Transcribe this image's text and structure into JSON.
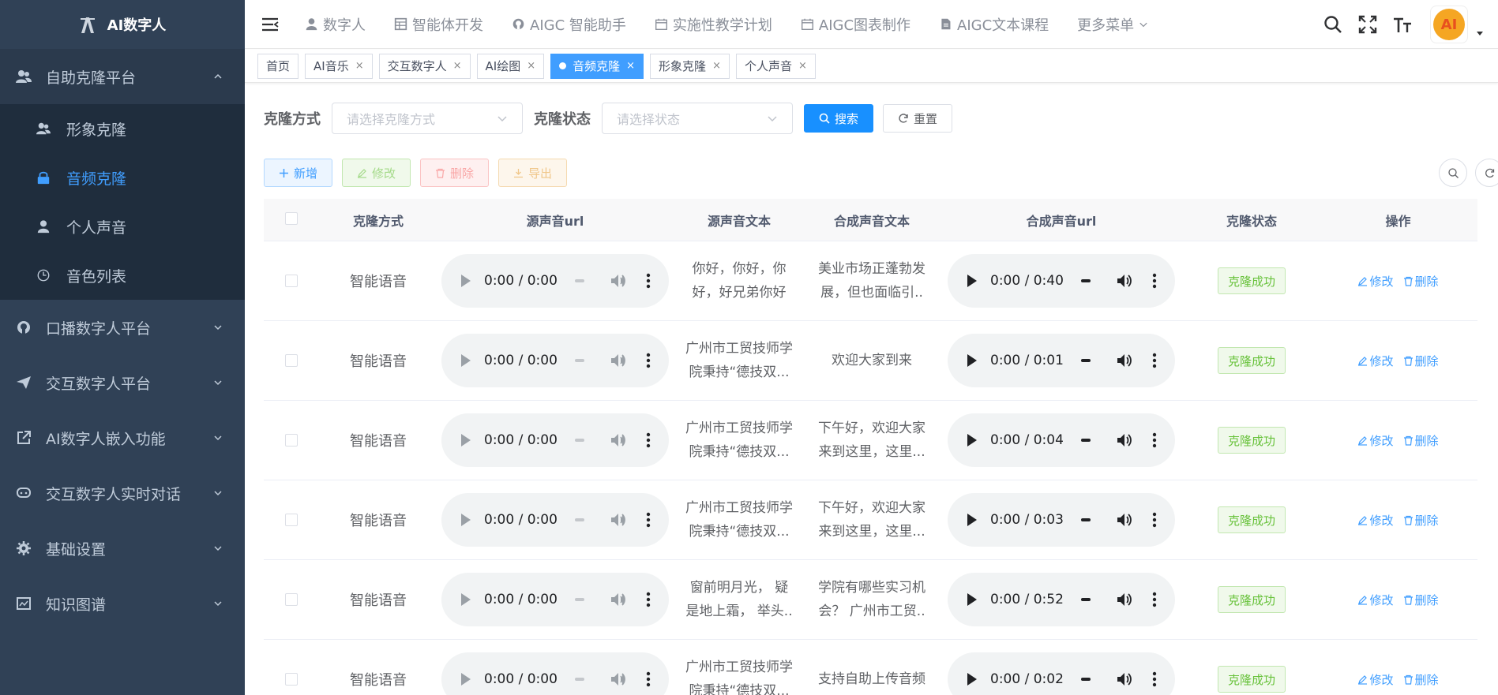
{
  "brand": {
    "title": "AI数字人"
  },
  "sidebar": {
    "groups": [
      {
        "label": "自助克隆平台",
        "icon": "users-icon",
        "open": true,
        "children": [
          {
            "label": "形象克隆",
            "icon": "users-icon"
          },
          {
            "label": "音频克隆",
            "icon": "lock-icon",
            "active": true
          },
          {
            "label": "个人声音",
            "icon": "user-icon"
          },
          {
            "label": "音色列表",
            "icon": "clock-icon"
          }
        ]
      },
      {
        "label": "口播数字人平台",
        "icon": "github-icon"
      },
      {
        "label": "交互数字人平台",
        "icon": "send-icon"
      },
      {
        "label": "AI数字人嵌入功能",
        "icon": "external-link-icon"
      },
      {
        "label": "交互数字人实时对话",
        "icon": "chat-icon"
      },
      {
        "label": "基础设置",
        "icon": "settings-icon"
      },
      {
        "label": "知识图谱",
        "icon": "chart-icon"
      }
    ]
  },
  "topnav": {
    "links": [
      {
        "label": "数字人",
        "icon": "user-icon"
      },
      {
        "label": "智能体开发",
        "icon": "table-icon"
      },
      {
        "label": "AIGC 智能助手",
        "icon": "github-icon"
      },
      {
        "label": "实施性教学计划",
        "icon": "calendar-icon"
      },
      {
        "label": "AIGC图表制作",
        "icon": "calendar-icon"
      },
      {
        "label": "AIGC文本课程",
        "icon": "document-icon"
      },
      {
        "label": "更多菜单",
        "icon": "chevron-down-icon"
      }
    ],
    "avatar_text": "AI"
  },
  "tags": [
    {
      "label": "首页",
      "closable": false,
      "active": false
    },
    {
      "label": "AI音乐",
      "closable": true,
      "active": false
    },
    {
      "label": "交互数字人",
      "closable": true,
      "active": false
    },
    {
      "label": "AI绘图",
      "closable": true,
      "active": false
    },
    {
      "label": "音频克隆",
      "closable": true,
      "active": true
    },
    {
      "label": "形象克隆",
      "closable": true,
      "active": false
    },
    {
      "label": "个人声音",
      "closable": true,
      "active": false
    }
  ],
  "filters": {
    "method_label": "克隆方式",
    "method_placeholder": "请选择克隆方式",
    "status_label": "克隆状态",
    "status_placeholder": "请选择状态",
    "search_label": "搜索",
    "reset_label": "重置"
  },
  "actions": {
    "add_label": "新增",
    "edit_label": "修改",
    "delete_label": "删除",
    "export_label": "导出"
  },
  "table": {
    "headers": [
      "克隆方式",
      "源声音url",
      "源声音文本",
      "合成声音文本",
      "合成声音url",
      "克隆状态",
      "操作"
    ],
    "rows": [
      {
        "method": "智能语音",
        "src_time": "0:00 / 0:00",
        "src_text": "你好，你好，你好，好兄弟你好",
        "syn_text": "美业市场正蓬勃发展，但也面临引..",
        "syn_time": "0:00 / 0:40",
        "status": "克隆成功",
        "edit": "修改",
        "delete": "删除"
      },
      {
        "method": "智能语音",
        "src_time": "0:00 / 0:00",
        "src_text": "广州市工贸技师学院秉持“德技双...",
        "syn_text": "欢迎大家到来",
        "syn_time": "0:00 / 0:01",
        "status": "克隆成功",
        "edit": "修改",
        "delete": "删除"
      },
      {
        "method": "智能语音",
        "src_time": "0:00 / 0:00",
        "src_text": "广州市工贸技师学院秉持“德技双...",
        "syn_text": "下午好，欢迎大家来到这里，这里...",
        "syn_time": "0:00 / 0:04",
        "status": "克隆成功",
        "edit": "修改",
        "delete": "删除"
      },
      {
        "method": "智能语音",
        "src_time": "0:00 / 0:00",
        "src_text": "广州市工贸技师学院秉持“德技双...",
        "syn_text": "下午好，欢迎大家来到这里，这里...",
        "syn_time": "0:00 / 0:03",
        "status": "克隆成功",
        "edit": "修改",
        "delete": "删除"
      },
      {
        "method": "智能语音",
        "src_time": "0:00 / 0:00",
        "src_text": "窗前明月光， 疑是地上霜， 举头..",
        "syn_text": "学院有哪些实习机会？ 广州市工贸..",
        "syn_time": "0:00 / 0:52",
        "status": "克隆成功",
        "edit": "修改",
        "delete": "删除"
      },
      {
        "method": "智能语音",
        "src_time": "0:00 / 0:00",
        "src_text": "广州市工贸技师学院秉持“德技双...",
        "syn_text": "支持自助上传音频",
        "syn_time": "0:00 / 0:02",
        "status": "克隆成功",
        "edit": "修改",
        "delete": "删除"
      }
    ]
  },
  "colors": {
    "sidebar_bg": "#304156",
    "submenu_bg": "#1f2d3d",
    "primary": "#409eff",
    "success": "#67c23a"
  }
}
